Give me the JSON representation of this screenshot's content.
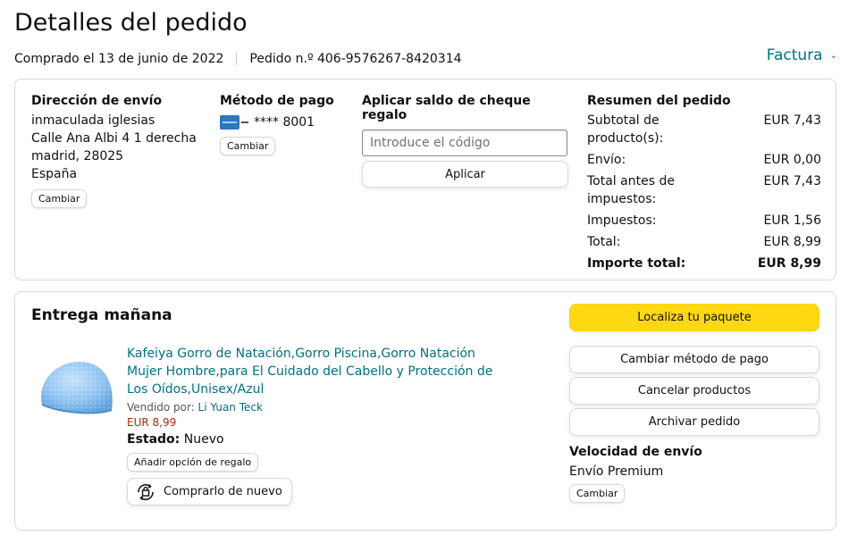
{
  "page": {
    "title": "Detalles del pedido",
    "purchased": "Comprado el 13 de junio de 2022",
    "order_number": "Pedido n.º 406-9576267-8420314",
    "invoice_label": "Factura"
  },
  "shipping_address": {
    "heading": "Dirección de envío",
    "lines": [
      "inmaculada iglesias",
      "Calle Ana Albi 4 1 derecha",
      "madrid, 28025",
      "España"
    ],
    "change_label": "Cambiar"
  },
  "payment": {
    "heading": "Método de pago",
    "card": "**** 8001",
    "card_icon": "amex-card-icon",
    "change_label": "Cambiar"
  },
  "gift_card": {
    "heading": "Aplicar saldo de cheque regalo",
    "placeholder": "Introduce el código",
    "apply_label": "Aplicar"
  },
  "summary": {
    "heading": "Resumen del pedido",
    "rows": [
      {
        "label": "Subtotal de producto(s):",
        "value": "EUR 7,43"
      },
      {
        "label": "Envío:",
        "value": "EUR 0,00"
      },
      {
        "label": "Total antes de impuestos:",
        "value": "EUR 7,43"
      },
      {
        "label": "Impuestos:",
        "value": "EUR 1,56"
      },
      {
        "label": "Total:",
        "value": "EUR 8,99"
      }
    ],
    "grand_total": {
      "label": "Importe total:",
      "value": "EUR 8,99"
    }
  },
  "delivery": {
    "title": "Entrega mañana",
    "product": {
      "name": "Kafeiya Gorro de Natación,Gorro Piscina,Gorro Natación Mujer Hombre,para El Cuidado del Cabello y Protección de Los Oídos,Unisex/Azul",
      "seller_prefix": "Vendido por:",
      "seller": "Li Yuan Teck",
      "price": "EUR 8,99",
      "status_label": "Estado:",
      "status_value": "Nuevo",
      "gift_option_label": "Añadir opción de regalo",
      "buy_again_label": "Comprarlo de nuevo"
    },
    "actions": {
      "track": "Localiza tu paquete",
      "change_payment": "Cambiar método de pago",
      "cancel": "Cancelar productos",
      "archive": "Archivar pedido"
    },
    "shipping_speed": {
      "heading": "Velocidad de envío",
      "value": "Envío Premium",
      "change_label": "Cambiar"
    }
  },
  "colors": {
    "link": "#007185",
    "price": "#B12704",
    "primary_button": "#FFD814",
    "border": "#D5D9D9"
  }
}
